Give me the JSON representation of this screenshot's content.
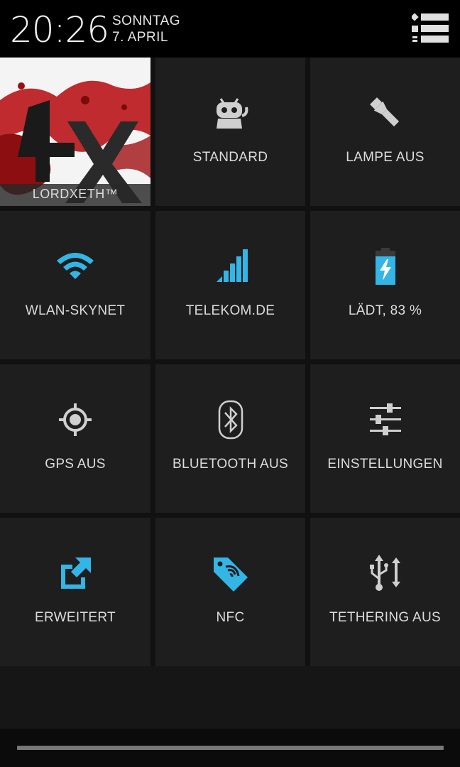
{
  "header": {
    "time": "20:26",
    "day": "SONNTAG",
    "date": "7. APRIL"
  },
  "tiles": {
    "user": {
      "label": "LORDXETH™"
    },
    "profile": {
      "label": "STANDARD",
      "icon": "cyanogenmod-mascot-icon"
    },
    "torch": {
      "label": "LAMPE AUS",
      "icon": "flashlight-icon"
    },
    "wifi": {
      "label": "WLAN-SKYNET",
      "icon": "wifi-icon"
    },
    "mobile": {
      "label": "TELEKOM.DE",
      "icon": "signal-bars-icon"
    },
    "battery": {
      "label": "LÄDT, 83 %",
      "icon": "battery-charging-icon",
      "level_percent": 83
    },
    "gps": {
      "label": "GPS AUS",
      "icon": "gps-icon"
    },
    "bluetooth": {
      "label": "BLUETOOTH AUS",
      "icon": "bluetooth-icon"
    },
    "settings": {
      "label": "EINSTELLUNGEN",
      "icon": "sliders-icon"
    },
    "expanded": {
      "label": "ERWEITERT",
      "icon": "expand-external-icon"
    },
    "nfc": {
      "label": "NFC",
      "icon": "nfc-tag-icon"
    },
    "tethering": {
      "label": "TETHERING AUS",
      "icon": "usb-icon"
    }
  },
  "colors": {
    "accent": "#33b5e5",
    "icon_gray": "#cfcfcf",
    "tile_bg": "#1e1e1e",
    "background": "#000000"
  }
}
